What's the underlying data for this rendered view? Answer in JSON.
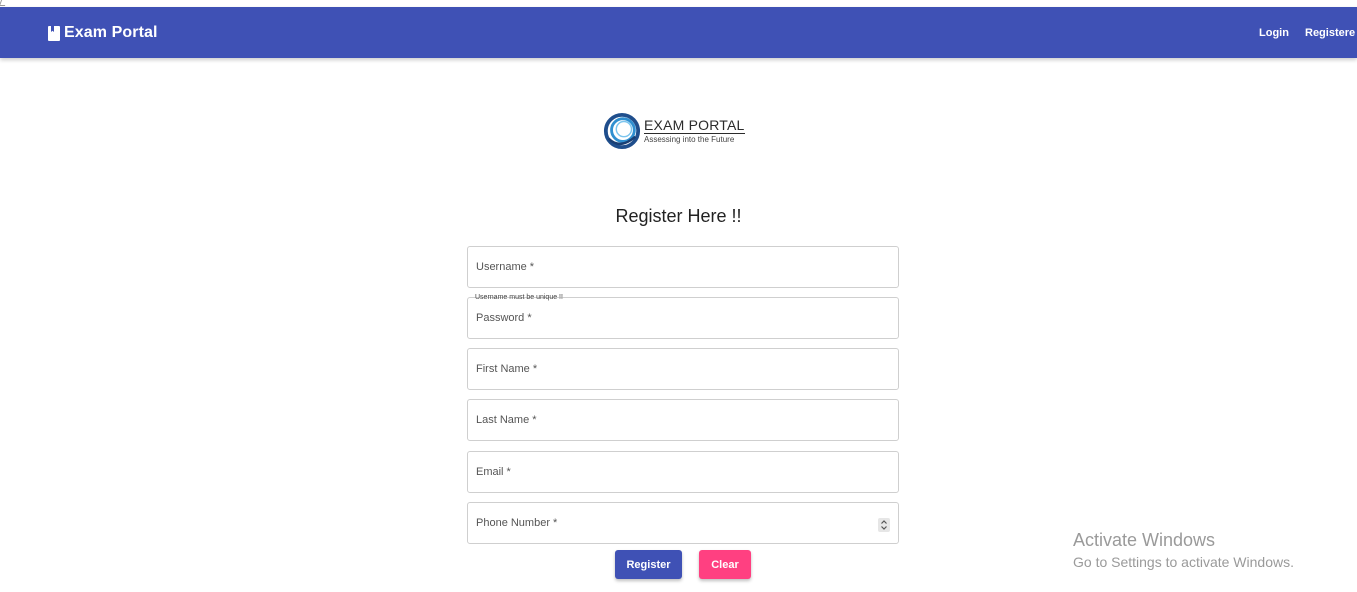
{
  "navbar": {
    "brand": "Exam Portal",
    "brand_icon": "book-icon",
    "links": {
      "login": "Login",
      "register": "Registere"
    },
    "color": "#3f51b5"
  },
  "logo": {
    "title": "EXAM PORTAL",
    "tagline": "Assessing into the Future"
  },
  "form": {
    "title": "Register Here !!",
    "fields": {
      "username": "Username *",
      "username_hint": "Username must be unique !!",
      "password": "Password *",
      "first_name": "First Name *",
      "last_name": "Last Name *",
      "email": "Email *",
      "phone": "Phone Number *"
    },
    "buttons": {
      "register": "Register",
      "clear": "Clear"
    },
    "colors": {
      "primary": "#3f51b5",
      "accent": "#ff4081"
    }
  },
  "watermark": {
    "line1": "Activate Windows",
    "line2": "Go to Settings to activate Windows."
  }
}
